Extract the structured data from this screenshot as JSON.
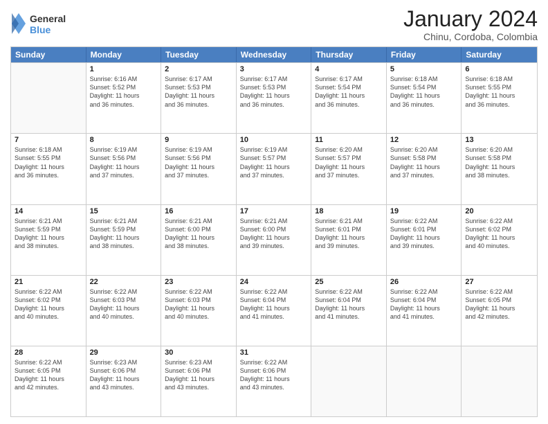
{
  "logo": {
    "general": "General",
    "blue": "Blue"
  },
  "title": "January 2024",
  "subtitle": "Chinu, Cordoba, Colombia",
  "days": [
    "Sunday",
    "Monday",
    "Tuesday",
    "Wednesday",
    "Thursday",
    "Friday",
    "Saturday"
  ],
  "weeks": [
    [
      {
        "date": "",
        "sunrise": "",
        "sunset": "",
        "daylight": ""
      },
      {
        "date": "1",
        "sunrise": "Sunrise: 6:16 AM",
        "sunset": "Sunset: 5:52 PM",
        "daylight": "Daylight: 11 hours and 36 minutes."
      },
      {
        "date": "2",
        "sunrise": "Sunrise: 6:17 AM",
        "sunset": "Sunset: 5:53 PM",
        "daylight": "Daylight: 11 hours and 36 minutes."
      },
      {
        "date": "3",
        "sunrise": "Sunrise: 6:17 AM",
        "sunset": "Sunset: 5:53 PM",
        "daylight": "Daylight: 11 hours and 36 minutes."
      },
      {
        "date": "4",
        "sunrise": "Sunrise: 6:17 AM",
        "sunset": "Sunset: 5:54 PM",
        "daylight": "Daylight: 11 hours and 36 minutes."
      },
      {
        "date": "5",
        "sunrise": "Sunrise: 6:18 AM",
        "sunset": "Sunset: 5:54 PM",
        "daylight": "Daylight: 11 hours and 36 minutes."
      },
      {
        "date": "6",
        "sunrise": "Sunrise: 6:18 AM",
        "sunset": "Sunset: 5:55 PM",
        "daylight": "Daylight: 11 hours and 36 minutes."
      }
    ],
    [
      {
        "date": "7",
        "sunrise": "Sunrise: 6:18 AM",
        "sunset": "Sunset: 5:55 PM",
        "daylight": "Daylight: 11 hours and 36 minutes."
      },
      {
        "date": "8",
        "sunrise": "Sunrise: 6:19 AM",
        "sunset": "Sunset: 5:56 PM",
        "daylight": "Daylight: 11 hours and 37 minutes."
      },
      {
        "date": "9",
        "sunrise": "Sunrise: 6:19 AM",
        "sunset": "Sunset: 5:56 PM",
        "daylight": "Daylight: 11 hours and 37 minutes."
      },
      {
        "date": "10",
        "sunrise": "Sunrise: 6:19 AM",
        "sunset": "Sunset: 5:57 PM",
        "daylight": "Daylight: 11 hours and 37 minutes."
      },
      {
        "date": "11",
        "sunrise": "Sunrise: 6:20 AM",
        "sunset": "Sunset: 5:57 PM",
        "daylight": "Daylight: 11 hours and 37 minutes."
      },
      {
        "date": "12",
        "sunrise": "Sunrise: 6:20 AM",
        "sunset": "Sunset: 5:58 PM",
        "daylight": "Daylight: 11 hours and 37 minutes."
      },
      {
        "date": "13",
        "sunrise": "Sunrise: 6:20 AM",
        "sunset": "Sunset: 5:58 PM",
        "daylight": "Daylight: 11 hours and 38 minutes."
      }
    ],
    [
      {
        "date": "14",
        "sunrise": "Sunrise: 6:21 AM",
        "sunset": "Sunset: 5:59 PM",
        "daylight": "Daylight: 11 hours and 38 minutes."
      },
      {
        "date": "15",
        "sunrise": "Sunrise: 6:21 AM",
        "sunset": "Sunset: 5:59 PM",
        "daylight": "Daylight: 11 hours and 38 minutes."
      },
      {
        "date": "16",
        "sunrise": "Sunrise: 6:21 AM",
        "sunset": "Sunset: 6:00 PM",
        "daylight": "Daylight: 11 hours and 38 minutes."
      },
      {
        "date": "17",
        "sunrise": "Sunrise: 6:21 AM",
        "sunset": "Sunset: 6:00 PM",
        "daylight": "Daylight: 11 hours and 39 minutes."
      },
      {
        "date": "18",
        "sunrise": "Sunrise: 6:21 AM",
        "sunset": "Sunset: 6:01 PM",
        "daylight": "Daylight: 11 hours and 39 minutes."
      },
      {
        "date": "19",
        "sunrise": "Sunrise: 6:22 AM",
        "sunset": "Sunset: 6:01 PM",
        "daylight": "Daylight: 11 hours and 39 minutes."
      },
      {
        "date": "20",
        "sunrise": "Sunrise: 6:22 AM",
        "sunset": "Sunset: 6:02 PM",
        "daylight": "Daylight: 11 hours and 40 minutes."
      }
    ],
    [
      {
        "date": "21",
        "sunrise": "Sunrise: 6:22 AM",
        "sunset": "Sunset: 6:02 PM",
        "daylight": "Daylight: 11 hours and 40 minutes."
      },
      {
        "date": "22",
        "sunrise": "Sunrise: 6:22 AM",
        "sunset": "Sunset: 6:03 PM",
        "daylight": "Daylight: 11 hours and 40 minutes."
      },
      {
        "date": "23",
        "sunrise": "Sunrise: 6:22 AM",
        "sunset": "Sunset: 6:03 PM",
        "daylight": "Daylight: 11 hours and 40 minutes."
      },
      {
        "date": "24",
        "sunrise": "Sunrise: 6:22 AM",
        "sunset": "Sunset: 6:04 PM",
        "daylight": "Daylight: 11 hours and 41 minutes."
      },
      {
        "date": "25",
        "sunrise": "Sunrise: 6:22 AM",
        "sunset": "Sunset: 6:04 PM",
        "daylight": "Daylight: 11 hours and 41 minutes."
      },
      {
        "date": "26",
        "sunrise": "Sunrise: 6:22 AM",
        "sunset": "Sunset: 6:04 PM",
        "daylight": "Daylight: 11 hours and 41 minutes."
      },
      {
        "date": "27",
        "sunrise": "Sunrise: 6:22 AM",
        "sunset": "Sunset: 6:05 PM",
        "daylight": "Daylight: 11 hours and 42 minutes."
      }
    ],
    [
      {
        "date": "28",
        "sunrise": "Sunrise: 6:22 AM",
        "sunset": "Sunset: 6:05 PM",
        "daylight": "Daylight: 11 hours and 42 minutes."
      },
      {
        "date": "29",
        "sunrise": "Sunrise: 6:23 AM",
        "sunset": "Sunset: 6:06 PM",
        "daylight": "Daylight: 11 hours and 43 minutes."
      },
      {
        "date": "30",
        "sunrise": "Sunrise: 6:23 AM",
        "sunset": "Sunset: 6:06 PM",
        "daylight": "Daylight: 11 hours and 43 minutes."
      },
      {
        "date": "31",
        "sunrise": "Sunrise: 6:22 AM",
        "sunset": "Sunset: 6:06 PM",
        "daylight": "Daylight: 11 hours and 43 minutes."
      },
      {
        "date": "",
        "sunrise": "",
        "sunset": "",
        "daylight": ""
      },
      {
        "date": "",
        "sunrise": "",
        "sunset": "",
        "daylight": ""
      },
      {
        "date": "",
        "sunrise": "",
        "sunset": "",
        "daylight": ""
      }
    ]
  ]
}
